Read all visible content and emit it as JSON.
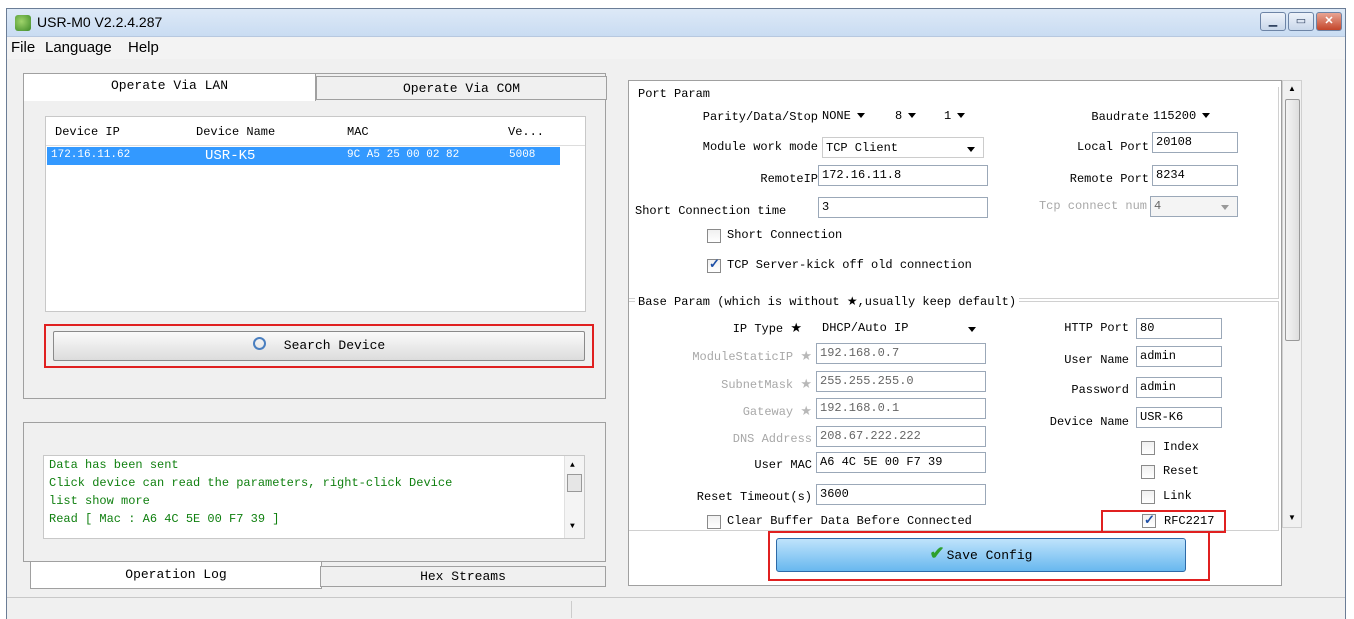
{
  "window": {
    "title": "USR-M0 V2.2.4.287",
    "min": "▁",
    "max": "▭",
    "close": "✕"
  },
  "menu": [
    "File",
    "Language",
    "Help"
  ],
  "left_tabs": [
    "Operate Via LAN",
    "Operate Via COM"
  ],
  "device_list": {
    "columns": [
      "Device IP",
      "Device Name",
      "MAC",
      "Ve..."
    ],
    "rows": [
      {
        "ip": "172.16.11.62",
        "name": "USR-K5",
        "mac": "9C A5 25 00 02 82",
        "ver": "5008"
      }
    ]
  },
  "search_button": "Search Device",
  "log": {
    "lines": [
      " Data has been sent",
      "Click device can read the parameters, right-click Device",
      "list show more",
      "Read [ Mac : A6 4C 5E 00 F7 39 ]"
    ]
  },
  "log_tabs": [
    "Operation Log",
    "Hex Streams"
  ],
  "port_param": {
    "title": "Port Param",
    "parity_label": "Parity/Data/Stop",
    "parity": "NONE",
    "data_bits": "8",
    "stop_bits": "1",
    "baud_label": "Baudrate",
    "baud": "115200",
    "mode_label": "Module work mode",
    "mode": "TCP Client",
    "local_port_label": "Local Port",
    "local_port": "20108",
    "remote_ip_label": "RemoteIP",
    "remote_ip": "172.16.11.8",
    "remote_port_label": "Remote Port",
    "remote_port": "8234",
    "short_time_label": "Short Connection time",
    "short_time": "3",
    "tcp_num_label": "Tcp connect num",
    "tcp_num": "4",
    "short_conn_label": "Short Connection",
    "kick_label": "TCP Server-kick off old connection"
  },
  "base_param": {
    "title": "Base Param (which is without ★,usually keep default)",
    "ip_type_label": "IP Type",
    "ip_type": "DHCP/Auto IP",
    "http_port_label": "HTTP Port",
    "http_port": "80",
    "static_ip_label": "ModuleStaticIP",
    "static_ip": "192.168.0.7",
    "user_label": "User Name",
    "user": "admin",
    "mask_label": "SubnetMask",
    "mask": "255.255.255.0",
    "pass_label": "Password",
    "pass": "admin",
    "gw_label": "Gateway",
    "gw": "192.168.0.1",
    "dev_name_label": "Device Name",
    "dev_name": "USR-K6",
    "dns_label": "DNS Address",
    "dns": "208.67.222.222",
    "mac_label": "User MAC",
    "mac": "A6 4C 5E 00 F7 39",
    "reset_to_label": "Reset Timeout(s)",
    "reset_to": "3600",
    "clear_label": "Clear Buffer Data Before Connected",
    "index_label": "Index",
    "reset_label": "Reset",
    "link_label": "Link",
    "rfc_label": "RFC2217"
  },
  "star": "★",
  "save_button": "Save Config",
  "check_glyph": "✔",
  "colors": {
    "highlight": "#e02020",
    "selection": "#3399ff",
    "log_text": "#108010"
  }
}
